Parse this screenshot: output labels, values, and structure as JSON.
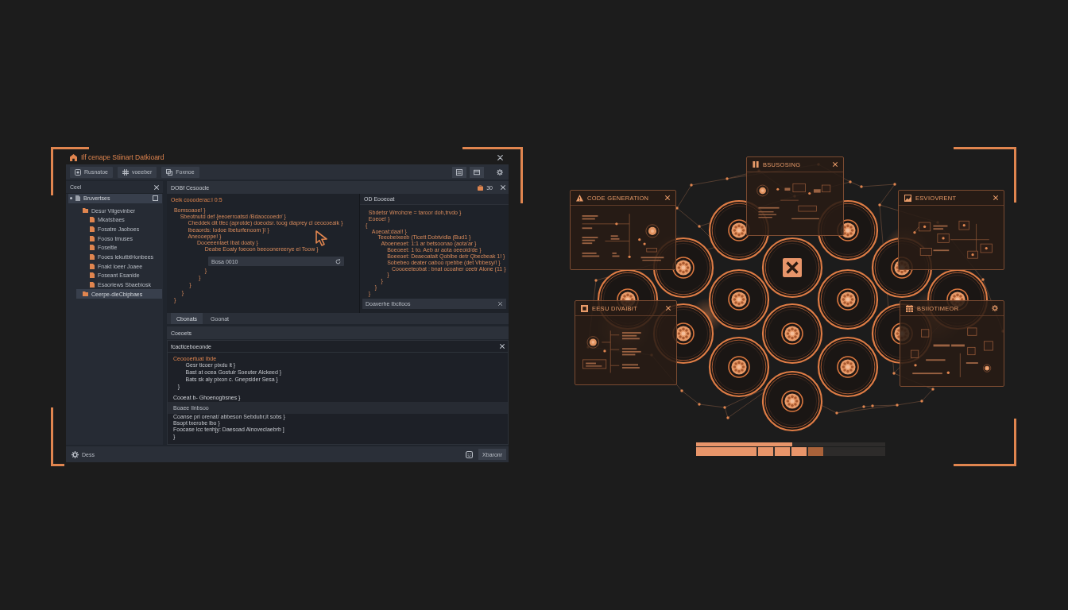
{
  "left_window": {
    "title": "Ilf cenape Stiinart Datkioard",
    "toolbar": {
      "buttons": [
        {
          "label": "Rusnatoe"
        },
        {
          "label": "voeeber"
        },
        {
          "label": "Foxnoe"
        }
      ]
    },
    "sidebar": {
      "title": "Ceel",
      "tree": [
        {
          "label": "Bruvertses",
          "selected": true,
          "children": [
            {
              "label": "Desur Vilgevinber",
              "selected": false,
              "children": [
                {
                  "label": "Mkatsbaes",
                  "selected": false
                },
                {
                  "label": "Fosatre Jaoboes",
                  "selected": false
                },
                {
                  "label": "Fooso tmuses",
                  "selected": false
                },
                {
                  "label": "Foseltle",
                  "selected": false
                },
                {
                  "label": "Fooes lekutbtHonbees",
                  "selected": false
                },
                {
                  "label": "Fnakt loeer Joaee",
                  "selected": false
                },
                {
                  "label": "Foseant Esanide",
                  "selected": false
                },
                {
                  "label": "Esaoriews Sbaebiosk",
                  "selected": false
                }
              ]
            },
            {
              "label": "Ceerpe-dieCbipbaes",
              "selected": true
            }
          ]
        }
      ]
    },
    "editor": {
      "title": "DOBf Cesoocle",
      "badge": "30",
      "left_pane": {
        "heading": "Oeik coooderac:I 0:5",
        "lines": [
          "  Bomsoaoe! }",
          "      Sbeotnutd def {eeoerroatsd /Bdaocooedr/ }",
          "           Cheddek dit tfec (aprotde) doeodsr. toog diaprey cl ceocoeaik }",
          "           Ibeaords: Iodoe Ibeturfenoom }! }",
          "           Aneooeppe! }",
          "                 Dooeeenlaet Ibat doaty }",
          "                      Deabe Eoaty foeoon beeoonereerye el Toow }"
        ],
        "field": {
          "value": "Bosa 0010"
        },
        "closing_lines": [
          "                      }",
          "                  }",
          "            }",
          "       }",
          "  }"
        ]
      },
      "right_pane": {
        "title": "OD Eooeoat",
        "lines": [
          "   Sbdetsr Wrrohcre = taroor doh,trvdo }",
          "   Eoeoe! }",
          " {",
          "     Aoeoat:daa!! }",
          "         Teeobeixeeb (Ticett Dobtvidla (Bud1 }",
          "           Aboeneoet: 1:1 ar betsoonao (aota'ar }",
          "               Boeoeet: 1 to. Aeb ar aota oeeoid/de }",
          "               Boeeoet: Deaeoatait Qoblbe detr Qbecbeak 1! }",
          "               Sobebeo deater oaboo rpebbe (det Vbbesy/! }",
          "                  Coooeeteobat : bnat ocoaher ceetr Alone (11 }",
          "               }",
          "           }",
          "       }",
          "   }"
        ],
        "footer": "Doaverhe Ibcitoos"
      }
    },
    "tabs": [
      {
        "label": "Cbonats",
        "selected": true
      },
      {
        "label": "Goonat",
        "selected": false
      }
    ],
    "section_title": "Coeoets",
    "output": {
      "title": "fcactlceboeonde",
      "heading": "Ceoooertuat Ibde",
      "lines": [
        "        Gesr ticoer pixdu it }",
        "        Bast at ocea Gostuir Soeuter Alckeed }",
        "        Bats sk aly pixon c. Gnepsider Sesa }",
        "   }"
      ],
      "result": "Cooeat b- Ghoenogbsnes }",
      "subheading": "Boaee Ilnbsoo",
      "sub_lines": [
        "Coanse pri orenat/ abbeson Sebdubr,it sobs }",
        "Bsopt txerobe lbo }",
        "Foocase lcc tenhjy: Daesoad Alnoveclaebrb ]",
        "}"
      ]
    },
    "status_bar": {
      "label": "Dess",
      "button": "Xbaronr"
    }
  },
  "diagram": {
    "panels": [
      {
        "title": "CODE GENERATION"
      },
      {
        "title": "BSUSOSING"
      },
      {
        "title": "ESVIOVRENT"
      },
      {
        "title": "EESU DIVAIBIT"
      },
      {
        "title": "BSIIOTIMEOR"
      }
    ],
    "nodes": [
      {
        "kind": "unit"
      },
      {
        "kind": "unit"
      },
      {
        "kind": "unit"
      },
      {
        "kind": "hub"
      },
      {
        "kind": "unit"
      },
      {
        "kind": "unit"
      },
      {
        "kind": "unit"
      },
      {
        "kind": "unit"
      },
      {
        "kind": "unit"
      },
      {
        "kind": "unit"
      },
      {
        "kind": "unit"
      },
      {
        "kind": "unit"
      },
      {
        "kind": "unit"
      },
      {
        "kind": "unit"
      },
      {
        "kind": "unit"
      }
    ]
  },
  "progress": {
    "level": 0.51,
    "segments": [
      {
        "kind": "major",
        "complete": true
      },
      {
        "kind": "minor",
        "complete": true
      },
      {
        "kind": "minor",
        "complete": true
      },
      {
        "kind": "minor",
        "complete": true
      },
      {
        "kind": "minor",
        "complete": false
      }
    ]
  }
}
